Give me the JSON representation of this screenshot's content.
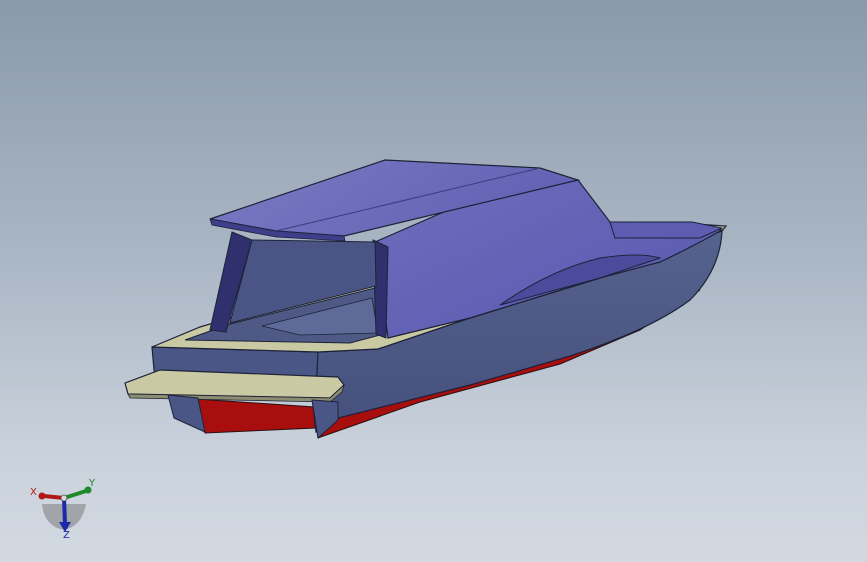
{
  "viewport": {
    "background_top": "#8a9aab",
    "background_bottom": "#d3d9e1"
  },
  "model": {
    "hull_color": "#4d5a86",
    "cabin_color": "#6a6ab8",
    "deck_color": "#c9c9a3",
    "bottom_color": "#a80e0e"
  },
  "triad": {
    "x_label": "X",
    "y_label": "Y",
    "z_label": "Z",
    "x_color": "#b01818",
    "y_color": "#1f8a2a",
    "z_color": "#1a2aa8"
  }
}
